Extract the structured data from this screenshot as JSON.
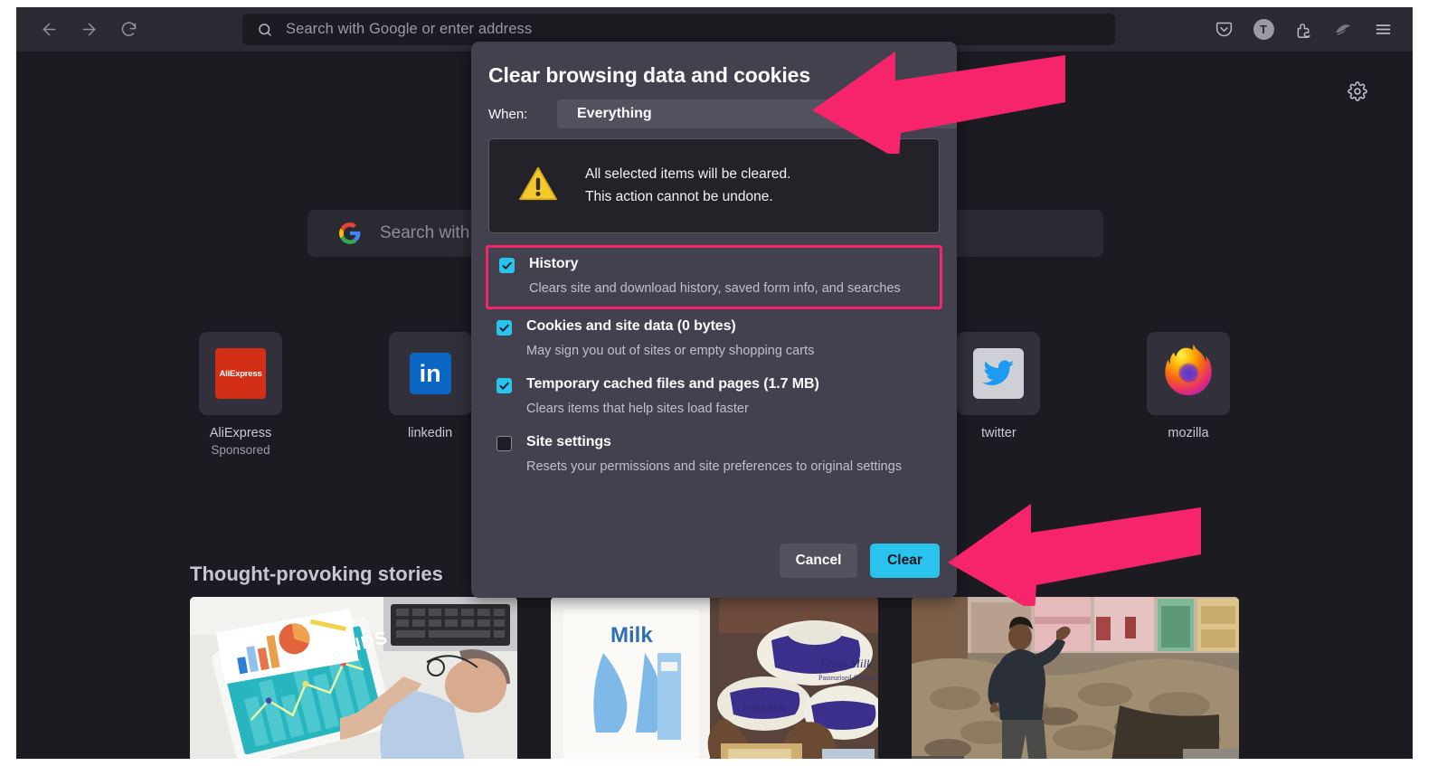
{
  "browser": {
    "nav": {
      "back_icon": "arrow-left-icon",
      "forward_icon": "arrow-right-icon",
      "reload_icon": "reload-icon"
    },
    "urlbar": {
      "icon": "search-icon",
      "placeholder": "Search with Google or enter address",
      "value": ""
    },
    "toolbar_right": [
      {
        "name": "pocket-icon",
        "label": ""
      },
      {
        "name": "account-avatar",
        "label": "T"
      },
      {
        "name": "extensions-icon",
        "label": ""
      },
      {
        "name": "container-tabs-icon",
        "label": ""
      },
      {
        "name": "app-menu-icon",
        "label": ""
      }
    ]
  },
  "newtab": {
    "settings_icon": "gear-icon",
    "search": {
      "logo": "google-logo",
      "placeholder": "Search with Google or enter address"
    },
    "shortcuts": [
      {
        "label": "AliExpress",
        "sublabel": "Sponsored",
        "icon": "aliexpress-logo",
        "badge_text": "AliExpress"
      },
      {
        "label": "linkedin",
        "sublabel": "",
        "icon": "linkedin-logo",
        "badge_text": "in"
      },
      {
        "label": "",
        "sublabel": "",
        "icon": "hidden-tile",
        "badge_text": ""
      },
      {
        "label": "",
        "sublabel": "",
        "icon": "hidden-tile",
        "badge_text": ""
      },
      {
        "label": "twitter",
        "sublabel": "",
        "icon": "twitter-logo",
        "badge_text": ""
      },
      {
        "label": "mozilla",
        "sublabel": "",
        "icon": "firefox-logo",
        "badge_text": ""
      }
    ],
    "stories_heading": "Thought-provoking stories",
    "cards": [
      {
        "name": "story-card-mutual-funds",
        "alt": "Person holding tablet showing MUTUAL FUNDS chart"
      },
      {
        "name": "story-card-milk",
        "alt": "Milk carton and fresh milk packets"
      },
      {
        "name": "story-card-rubble",
        "alt": "Man standing beside demolished building rubble"
      }
    ]
  },
  "dialog": {
    "title": "Clear browsing data and cookies",
    "when_label": "When:",
    "when_value": "Everything",
    "when_options": [
      "Everything"
    ],
    "warning": {
      "icon": "warning-triangle-icon",
      "line1": "All selected items will be cleared.",
      "line2": "This action cannot be undone."
    },
    "options": [
      {
        "label": "History",
        "description": "Clears site and download history, saved form info, and searches",
        "checked": true,
        "highlighted": true
      },
      {
        "label": "Cookies and site data (0 bytes)",
        "description": "May sign you out of sites or empty shopping carts",
        "checked": true,
        "highlighted": false
      },
      {
        "label": "Temporary cached files and pages (1.7 MB)",
        "description": "Clears items that help sites load faster",
        "checked": true,
        "highlighted": false
      },
      {
        "label": "Site settings",
        "description": "Resets your permissions and site preferences to original settings",
        "checked": false,
        "highlighted": false
      }
    ],
    "cancel_label": "Cancel",
    "clear_label": "Clear"
  },
  "annotations": {
    "accent_color": "#f5246b",
    "arrows": [
      {
        "name": "arrow-pointing-to-when-dropdown",
        "target": "when-dropdown"
      },
      {
        "name": "arrow-pointing-to-clear-button",
        "target": "clear-button"
      }
    ]
  },
  "colors": {
    "chrome_bg": "#2b2a33",
    "page_bg": "#1c1b22",
    "dialog_bg": "#42414d",
    "accent_cyan": "#2ac3ee",
    "accent_pink": "#f5246b",
    "tile_bg": "#32313b"
  }
}
